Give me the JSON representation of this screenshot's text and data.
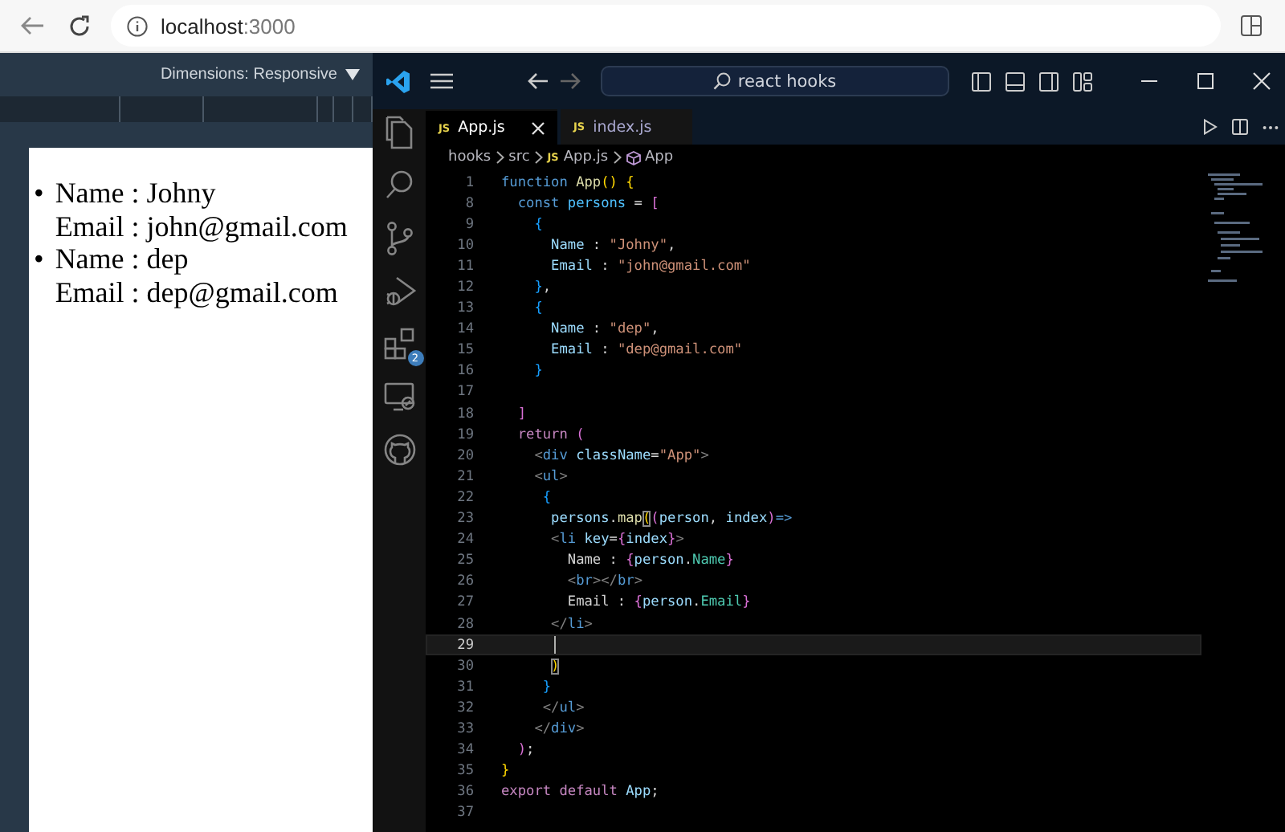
{
  "browser": {
    "address": {
      "host": "localhost",
      "port": ":3000"
    }
  },
  "devtools": {
    "dimensions_label": "Dimensions: Responsive"
  },
  "page_preview": {
    "items": [
      {
        "marker": "•",
        "name_line": "Name : Johny",
        "email_line": "Email : john@gmail.com"
      },
      {
        "marker": "•",
        "name_line": "Name : dep",
        "email_line": "Email : dep@gmail.com"
      }
    ]
  },
  "editor": {
    "search": "react hooks",
    "activity_bar": [
      {
        "kind": "explorer"
      },
      {
        "kind": "search"
      },
      {
        "kind": "source-control"
      },
      {
        "kind": "run-debug"
      },
      {
        "kind": "extensions",
        "badge": "2"
      },
      {
        "kind": "remote"
      },
      {
        "kind": "github"
      }
    ],
    "tabs": [
      {
        "label": "App.js",
        "file_icon": "JS",
        "selected": true
      },
      {
        "label": "index.js",
        "file_icon": "JS",
        "selected": false
      }
    ],
    "breadcrumb": [
      {
        "text": "hooks",
        "kind": "folder"
      },
      {
        "text": "src",
        "kind": "folder"
      },
      {
        "text": "App.js",
        "kind": "file",
        "file_icon": "JS"
      },
      {
        "text": "App",
        "kind": "symbol"
      }
    ],
    "lines": [
      {
        "number": "1",
        "tokens": [
          {
            "text": "function",
            "kind": "keyword"
          },
          {
            "text": " App",
            "kind": "function"
          },
          {
            "text": "()",
            "kind": "bracket1"
          },
          {
            "text": " {",
            "kind": "bracket1"
          }
        ]
      },
      {
        "number": "8",
        "tokens": [
          {
            "text": "  const",
            "kind": "keyword"
          },
          {
            "text": " persons",
            "kind": "constant"
          },
          {
            "text": " =",
            "kind": "punct"
          },
          {
            "text": " [",
            "kind": "bracket2"
          }
        ]
      },
      {
        "number": "9",
        "tokens": [
          {
            "text": "    {",
            "kind": "bracket3"
          }
        ]
      },
      {
        "number": "10",
        "tokens": [
          {
            "text": "      Name",
            "kind": "variable"
          },
          {
            "text": " :",
            "kind": "punct"
          },
          {
            "text": " \"Johny\"",
            "kind": "string"
          },
          {
            "text": ",",
            "kind": "punct"
          }
        ]
      },
      {
        "number": "11",
        "tokens": [
          {
            "text": "      Email",
            "kind": "variable"
          },
          {
            "text": " :",
            "kind": "punct"
          },
          {
            "text": " \"john@gmail.com\"",
            "kind": "string"
          }
        ]
      },
      {
        "number": "12",
        "tokens": [
          {
            "text": "    }",
            "kind": "bracket3"
          },
          {
            "text": ",",
            "kind": "punct"
          }
        ]
      },
      {
        "number": "13",
        "tokens": [
          {
            "text": "    {",
            "kind": "bracket3"
          }
        ]
      },
      {
        "number": "14",
        "tokens": [
          {
            "text": "      Name",
            "kind": "variable"
          },
          {
            "text": " :",
            "kind": "punct"
          },
          {
            "text": " \"dep\"",
            "kind": "string"
          },
          {
            "text": ",",
            "kind": "punct"
          }
        ]
      },
      {
        "number": "15",
        "tokens": [
          {
            "text": "      Email",
            "kind": "variable"
          },
          {
            "text": " :",
            "kind": "punct"
          },
          {
            "text": " \"dep@gmail.com\"",
            "kind": "string"
          }
        ]
      },
      {
        "number": "16",
        "tokens": [
          {
            "text": "    }",
            "kind": "bracket3"
          }
        ]
      },
      {
        "number": "17"
      },
      {
        "number": "18",
        "tokens": [
          {
            "text": "  ]",
            "kind": "bracket2"
          }
        ]
      },
      {
        "number": "19",
        "tokens": [
          {
            "text": "  return",
            "kind": "control"
          },
          {
            "text": " (",
            "kind": "bracket2"
          }
        ]
      },
      {
        "number": "20",
        "tokens": [
          {
            "text": "    <",
            "kind": "angle"
          },
          {
            "text": "div",
            "kind": "tag"
          },
          {
            "text": " className",
            "kind": "attr"
          },
          {
            "text": "=",
            "kind": "punct"
          },
          {
            "text": "\"App\"",
            "kind": "string"
          },
          {
            "text": ">",
            "kind": "angle"
          }
        ]
      },
      {
        "number": "21",
        "tokens": [
          {
            "text": "    <",
            "kind": "angle"
          },
          {
            "text": "ul",
            "kind": "tag"
          },
          {
            "text": ">",
            "kind": "angle"
          }
        ]
      },
      {
        "number": "22",
        "tokens": [
          {
            "text": "     {",
            "kind": "bracket3"
          }
        ]
      },
      {
        "number": "23",
        "tokens": [
          {
            "text": "      persons",
            "kind": "variable"
          },
          {
            "text": ".",
            "kind": "punct"
          },
          {
            "text": "map",
            "kind": "function"
          },
          {
            "text": "(",
            "kind": "bracket-match"
          },
          {
            "text": "(",
            "kind": "bracket2"
          },
          {
            "text": "person",
            "kind": "variable"
          },
          {
            "text": ", ",
            "kind": "punct"
          },
          {
            "text": "index",
            "kind": "variable"
          },
          {
            "text": ")",
            "kind": "bracket2"
          },
          {
            "text": "=>",
            "kind": "keyword"
          }
        ]
      },
      {
        "number": "24",
        "tokens": [
          {
            "text": "      <",
            "kind": "angle"
          },
          {
            "text": "li",
            "kind": "tag"
          },
          {
            "text": " key",
            "kind": "attr"
          },
          {
            "text": "=",
            "kind": "punct"
          },
          {
            "text": "{",
            "kind": "bracket2"
          },
          {
            "text": "index",
            "kind": "variable"
          },
          {
            "text": "}",
            "kind": "bracket2"
          },
          {
            "text": ">",
            "kind": "angle"
          }
        ]
      },
      {
        "number": "25",
        "tokens": [
          {
            "text": "        Name :",
            "kind": "text"
          },
          {
            "text": " {",
            "kind": "bracket2"
          },
          {
            "text": "person",
            "kind": "variable"
          },
          {
            "text": ".",
            "kind": "punct"
          },
          {
            "text": "Name",
            "kind": "member"
          },
          {
            "text": "}",
            "kind": "bracket2"
          }
        ]
      },
      {
        "number": "26",
        "tokens": [
          {
            "text": "        <",
            "kind": "angle"
          },
          {
            "text": "br",
            "kind": "tag"
          },
          {
            "text": "></",
            "kind": "angle"
          },
          {
            "text": "br",
            "kind": "tag"
          },
          {
            "text": ">",
            "kind": "angle"
          }
        ]
      },
      {
        "number": "27",
        "tokens": [
          {
            "text": "        Email :",
            "kind": "text"
          },
          {
            "text": " {",
            "kind": "bracket2"
          },
          {
            "text": "person",
            "kind": "variable"
          },
          {
            "text": ".",
            "kind": "punct"
          },
          {
            "text": "Email",
            "kind": "member"
          },
          {
            "text": "}",
            "kind": "bracket2"
          }
        ]
      },
      {
        "number": "28",
        "tokens": [
          {
            "text": "      </",
            "kind": "angle"
          },
          {
            "text": "li",
            "kind": "tag"
          },
          {
            "text": ">",
            "kind": "angle"
          }
        ]
      },
      {
        "number": "29",
        "current": true
      },
      {
        "number": "30",
        "tokens": [
          {
            "text": "      )",
            "kind": "bracket-match"
          }
        ]
      },
      {
        "number": "31",
        "tokens": [
          {
            "text": "     }",
            "kind": "bracket3"
          }
        ]
      },
      {
        "number": "32",
        "tokens": [
          {
            "text": "     </",
            "kind": "angle"
          },
          {
            "text": "ul",
            "kind": "tag"
          },
          {
            "text": ">",
            "kind": "angle"
          }
        ]
      },
      {
        "number": "33",
        "tokens": [
          {
            "text": "    </",
            "kind": "angle"
          },
          {
            "text": "div",
            "kind": "tag"
          },
          {
            "text": ">",
            "kind": "angle"
          }
        ]
      },
      {
        "number": "34",
        "tokens": [
          {
            "text": "  )",
            "kind": "bracket2"
          },
          {
            "text": ";",
            "kind": "punct"
          }
        ]
      },
      {
        "number": "35",
        "tokens": [
          {
            "text": "}",
            "kind": "bracket1"
          }
        ]
      },
      {
        "number": "36",
        "tokens": [
          {
            "text": "export",
            "kind": "control"
          },
          {
            "text": " default",
            "kind": "control"
          },
          {
            "text": " App",
            "kind": "variable"
          },
          {
            "text": ";",
            "kind": "punct"
          }
        ]
      },
      {
        "number": "37"
      }
    ]
  }
}
